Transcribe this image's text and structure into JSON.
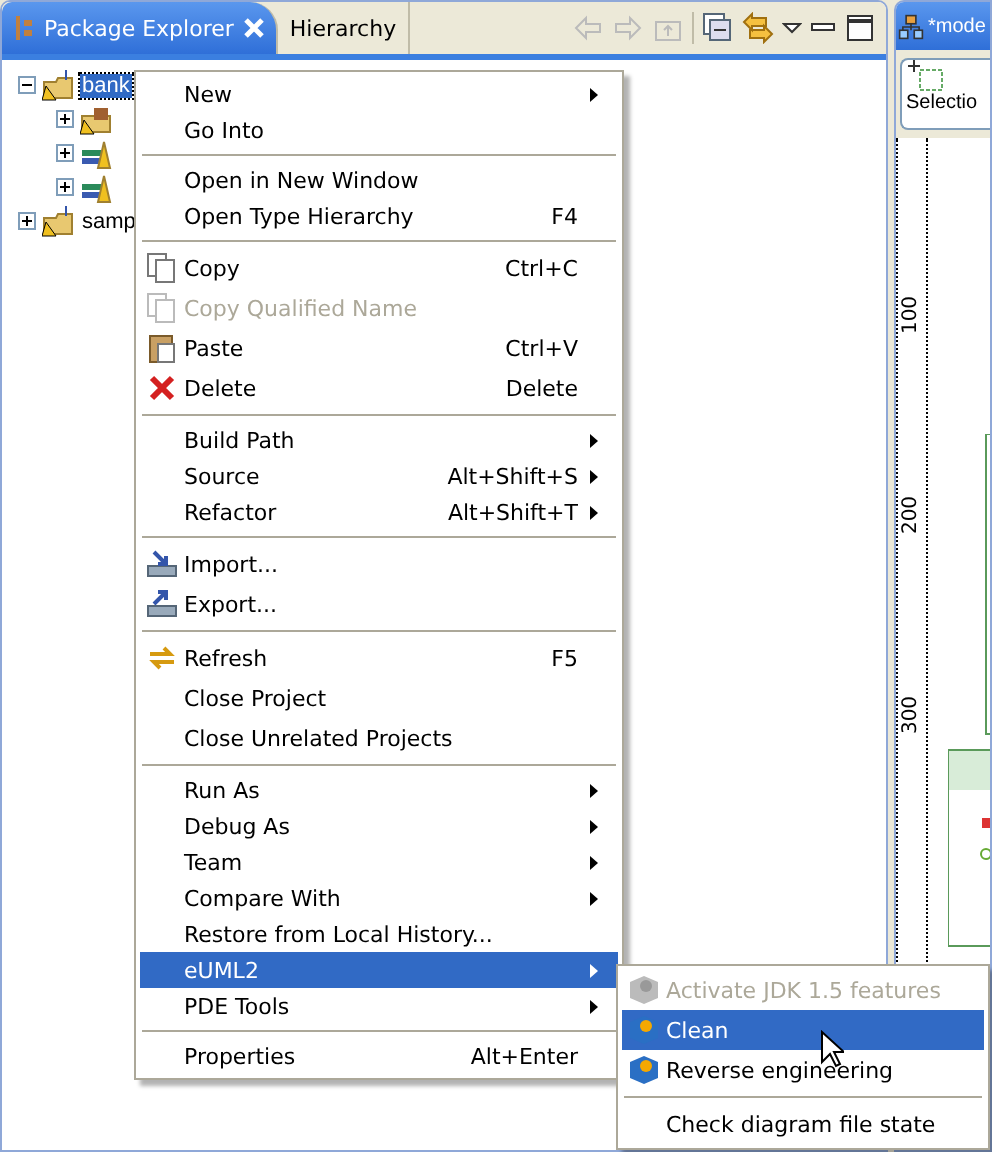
{
  "left_panel": {
    "tabs": [
      {
        "label": "Package Explorer",
        "selected": true,
        "closable": true
      },
      {
        "label": "Hierarchy",
        "selected": false,
        "closable": false
      }
    ],
    "toolbar": [
      {
        "kind": "back",
        "disabled": true
      },
      {
        "kind": "forward",
        "disabled": true
      },
      {
        "kind": "up",
        "disabled": true
      },
      {
        "kind": "sep"
      },
      {
        "kind": "collapse",
        "disabled": false
      },
      {
        "kind": "link",
        "disabled": false
      },
      {
        "kind": "menu"
      },
      {
        "kind": "minimize"
      },
      {
        "kind": "maximize"
      }
    ],
    "tree": [
      {
        "label": "bank",
        "kind": "project",
        "selected": true,
        "expanded": true,
        "children": [
          {
            "kind": "package",
            "expanded": false
          },
          {
            "kind": "library",
            "expanded": false
          },
          {
            "kind": "library",
            "expanded": false
          }
        ]
      },
      {
        "label": "samp",
        "kind": "project",
        "selected": false,
        "expanded": false
      }
    ]
  },
  "right_panel": {
    "title": "*mode",
    "tool": "Selectio",
    "ruler": [
      "100",
      "200",
      "300"
    ]
  },
  "context_menu": {
    "groups": [
      [
        {
          "label": "New",
          "submenu": true,
          "selected": false,
          "disabled": false
        },
        {
          "label": "Go Into",
          "submenu": false,
          "selected": false,
          "disabled": false
        }
      ],
      [
        {
          "label": "Open in New Window",
          "submenu": false,
          "selected": false,
          "disabled": false
        },
        {
          "label": "Open Type Hierarchy",
          "shortcut": "F4",
          "submenu": false,
          "selected": false,
          "disabled": false
        }
      ],
      [
        {
          "label": "Copy",
          "shortcut": "Ctrl+C",
          "kind": "copy",
          "submenu": false,
          "selected": false,
          "disabled": false
        },
        {
          "label": "Copy Qualified Name",
          "kind": "copy",
          "submenu": false,
          "selected": false,
          "disabled": true
        },
        {
          "label": "Paste",
          "shortcut": "Ctrl+V",
          "kind": "paste",
          "submenu": false,
          "selected": false,
          "disabled": false
        },
        {
          "label": "Delete",
          "shortcut": "Delete",
          "kind": "delete",
          "submenu": false,
          "selected": false,
          "disabled": false
        }
      ],
      [
        {
          "label": "Build Path",
          "submenu": true,
          "selected": false,
          "disabled": false
        },
        {
          "label": "Source",
          "shortcut": "Alt+Shift+S",
          "submenu": true,
          "selected": false,
          "disabled": false
        },
        {
          "label": "Refactor",
          "shortcut": "Alt+Shift+T",
          "submenu": true,
          "selected": false,
          "disabled": false
        }
      ],
      [
        {
          "label": "Import...",
          "kind": "import",
          "submenu": false,
          "selected": false,
          "disabled": false
        },
        {
          "label": "Export...",
          "kind": "export",
          "submenu": false,
          "selected": false,
          "disabled": false
        }
      ],
      [
        {
          "label": "Refresh",
          "shortcut": "F5",
          "kind": "refresh",
          "submenu": false,
          "selected": false,
          "disabled": false
        },
        {
          "label": "Close Project",
          "submenu": false,
          "selected": false,
          "disabled": false
        },
        {
          "label": "Close Unrelated Projects",
          "submenu": false,
          "selected": false,
          "disabled": false
        }
      ],
      [
        {
          "label": "Run As",
          "submenu": true,
          "selected": false,
          "disabled": false
        },
        {
          "label": "Debug As",
          "submenu": true,
          "selected": false,
          "disabled": false
        },
        {
          "label": "Team",
          "submenu": true,
          "selected": false,
          "disabled": false
        },
        {
          "label": "Compare With",
          "submenu": true,
          "selected": false,
          "disabled": false
        },
        {
          "label": "Restore from Local History...",
          "submenu": false,
          "selected": false,
          "disabled": false
        },
        {
          "label": "eUML2",
          "submenu": true,
          "selected": true,
          "disabled": false
        },
        {
          "label": "PDE Tools",
          "submenu": true,
          "selected": false,
          "disabled": false
        }
      ],
      [
        {
          "label": "Properties",
          "shortcut": "Alt+Enter",
          "submenu": false,
          "selected": false,
          "disabled": false
        }
      ]
    ]
  },
  "submenu": {
    "groups": [
      [
        {
          "label": "Activate JDK 1.5 features",
          "kind": "cube",
          "selected": false,
          "disabled": true
        },
        {
          "label": "Clean",
          "kind": "cube",
          "selected": true,
          "disabled": false
        },
        {
          "label": "Reverse engineering",
          "kind": "cube",
          "selected": false,
          "disabled": false
        }
      ],
      [
        {
          "label": "Check diagram file state",
          "selected": false,
          "disabled": false
        }
      ]
    ]
  }
}
